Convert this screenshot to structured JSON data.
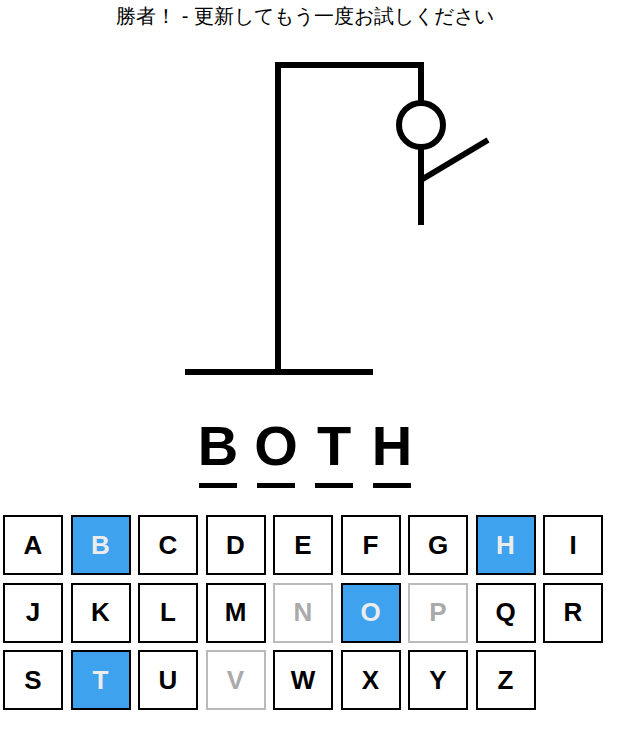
{
  "message": "勝者！ - 更新してもう一度お試しください",
  "hangman": {
    "mistakes": 3
  },
  "word": [
    {
      "letter": "B",
      "revealed": true
    },
    {
      "letter": "O",
      "revealed": true
    },
    {
      "letter": "T",
      "revealed": true
    },
    {
      "letter": "H",
      "revealed": true
    }
  ],
  "keyboard": [
    [
      {
        "label": "A",
        "guessed": false,
        "correct": false
      },
      {
        "label": "B",
        "guessed": true,
        "correct": true
      },
      {
        "label": "C",
        "guessed": false,
        "correct": false
      },
      {
        "label": "D",
        "guessed": false,
        "correct": false
      },
      {
        "label": "E",
        "guessed": false,
        "correct": false
      },
      {
        "label": "F",
        "guessed": false,
        "correct": false
      },
      {
        "label": "G",
        "guessed": false,
        "correct": false
      },
      {
        "label": "H",
        "guessed": true,
        "correct": true
      },
      {
        "label": "I",
        "guessed": false,
        "correct": false
      }
    ],
    [
      {
        "label": "J",
        "guessed": false,
        "correct": false
      },
      {
        "label": "K",
        "guessed": false,
        "correct": false
      },
      {
        "label": "L",
        "guessed": false,
        "correct": false
      },
      {
        "label": "M",
        "guessed": false,
        "correct": false
      },
      {
        "label": "N",
        "guessed": true,
        "correct": false
      },
      {
        "label": "O",
        "guessed": true,
        "correct": true
      },
      {
        "label": "P",
        "guessed": true,
        "correct": false
      },
      {
        "label": "Q",
        "guessed": false,
        "correct": false
      },
      {
        "label": "R",
        "guessed": false,
        "correct": false
      }
    ],
    [
      {
        "label": "S",
        "guessed": false,
        "correct": false
      },
      {
        "label": "T",
        "guessed": true,
        "correct": true
      },
      {
        "label": "U",
        "guessed": false,
        "correct": false
      },
      {
        "label": "V",
        "guessed": true,
        "correct": false
      },
      {
        "label": "W",
        "guessed": false,
        "correct": false
      },
      {
        "label": "X",
        "guessed": false,
        "correct": false
      },
      {
        "label": "Y",
        "guessed": false,
        "correct": false
      },
      {
        "label": "Z",
        "guessed": false,
        "correct": false
      }
    ]
  ]
}
